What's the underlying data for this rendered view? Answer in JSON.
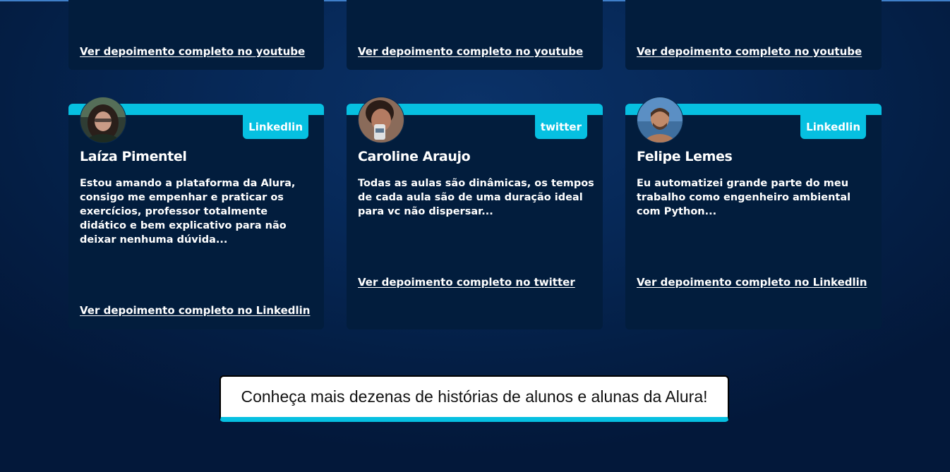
{
  "top_cards": [
    {
      "link": "Ver depoimento completo no youtube"
    },
    {
      "link": "Ver depoimento completo no youtube"
    },
    {
      "link": "Ver depoimento completo no youtube"
    }
  ],
  "testimonials": [
    {
      "name": "Laíza Pimentel",
      "badge": "Linkedlin",
      "text": "Estou amando a plataforma da Alura, consigo me empenhar e praticar os exercícios, professor totalmente didático e bem explicativo para não deixar nenhuma dúvida...",
      "link": "Ver depoimento completo no Linkedlin"
    },
    {
      "name": "Caroline Araujo",
      "badge": "twitter",
      "text": "Todas as aulas são dinâmicas, os tempos de cada aula são de uma duração ideal para vc não dispersar...",
      "link": "Ver depoimento completo no twitter"
    },
    {
      "name": "Felipe Lemes",
      "badge": "Linkedlin",
      "text": "Eu automatizei grande parte do meu trabalho como engenheiro ambiental com Python...",
      "link": "Ver depoimento completo no Linkedlin"
    }
  ],
  "cta": {
    "label": "Conheça mais dezenas de histórias de alunos e alunas da Alura!"
  },
  "colors": {
    "background": "#062857",
    "card": "#021d3d",
    "accent": "#06c0e1",
    "text": "#ffffff"
  }
}
